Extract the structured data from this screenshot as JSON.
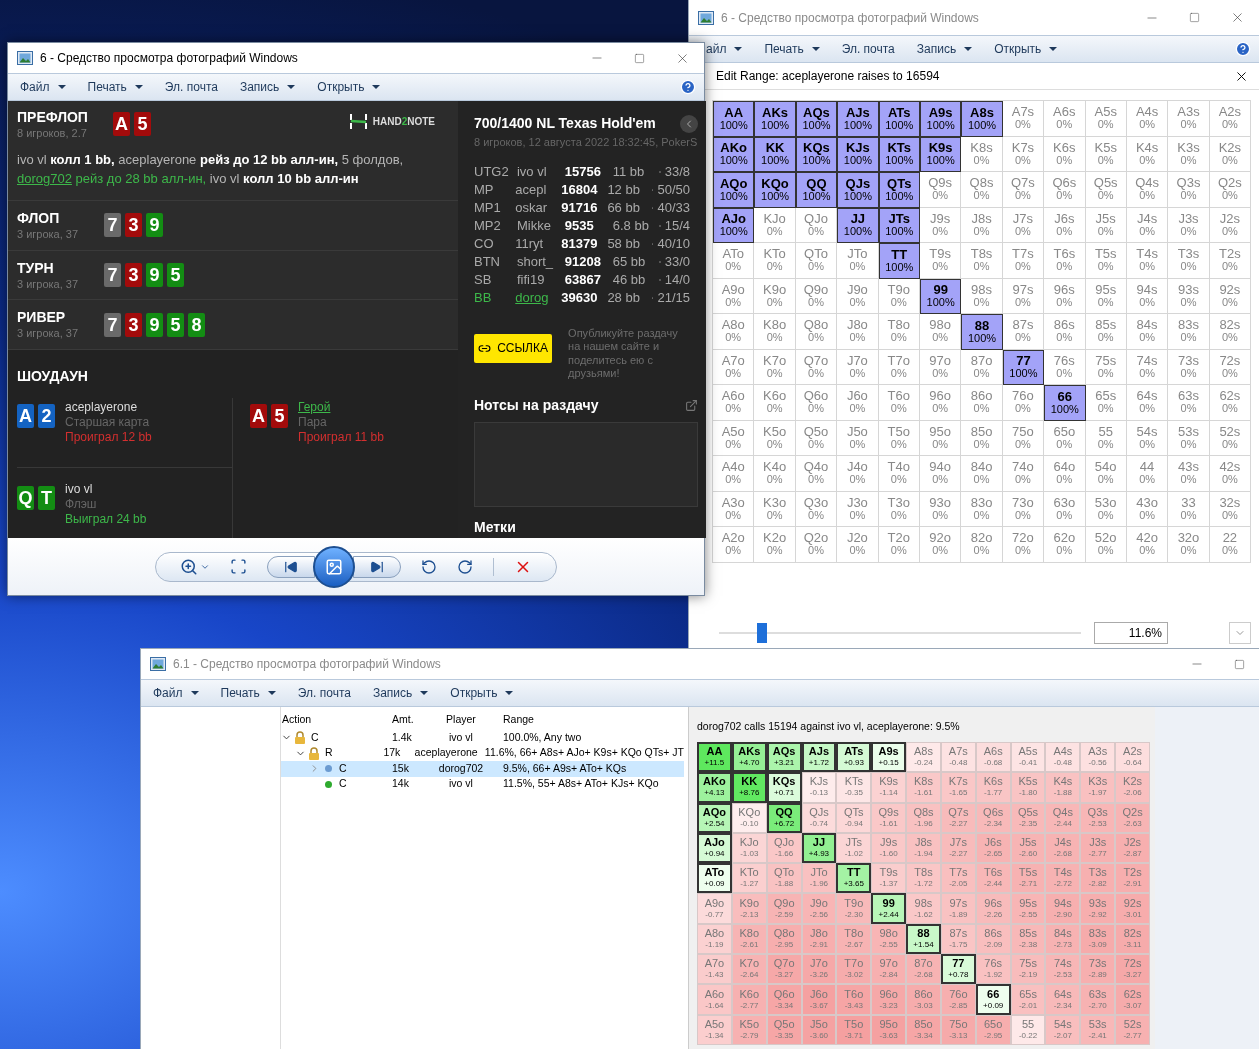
{
  "range_window": {
    "title": "6 - Средство просмотра фотографий Windows",
    "active": false,
    "menu": [
      {
        "label": "айл",
        "dropdown": true
      },
      {
        "label": "Печать",
        "dropdown": true
      },
      {
        "label": "Эл. почта",
        "dropdown": false
      },
      {
        "label": "Запись",
        "dropdown": true
      },
      {
        "label": "Открыть",
        "dropdown": true
      }
    ],
    "dialog_title": "Edit Range: aceplayerone raises to 16594",
    "grid": [
      [
        {
          "hand": "AA",
          "value": "100%",
          "selected": true
        },
        {
          "hand": "AKs",
          "value": "100%",
          "selected": true
        },
        {
          "hand": "AQs",
          "value": "100%",
          "selected": true
        },
        {
          "hand": "AJs",
          "value": "100%",
          "selected": true
        },
        {
          "hand": "ATs",
          "value": "100%",
          "selected": true
        },
        {
          "hand": "A9s",
          "value": "100%",
          "selected": true
        },
        {
          "hand": "A8s",
          "value": "100%",
          "selected": true
        },
        {
          "hand": "A7s",
          "value": "0%",
          "selected": false
        },
        {
          "hand": "A6s",
          "value": "0%",
          "selected": false
        },
        {
          "hand": "A5s",
          "value": "0%",
          "selected": false
        },
        {
          "hand": "A4s",
          "value": "0%",
          "selected": false
        },
        {
          "hand": "A3s",
          "value": "0%",
          "selected": false
        },
        {
          "hand": "A2s",
          "value": "0%",
          "selected": false
        }
      ],
      [
        {
          "hand": "AKo",
          "value": "100%",
          "selected": true
        },
        {
          "hand": "KK",
          "value": "100%",
          "selected": true
        },
        {
          "hand": "KQs",
          "value": "100%",
          "selected": true
        },
        {
          "hand": "KJs",
          "value": "100%",
          "selected": true
        },
        {
          "hand": "KTs",
          "value": "100%",
          "selected": true
        },
        {
          "hand": "K9s",
          "value": "100%",
          "selected": true
        },
        {
          "hand": "K8s",
          "value": "0%",
          "selected": false
        },
        {
          "hand": "K7s",
          "value": "0%",
          "selected": false
        },
        {
          "hand": "K6s",
          "value": "0%",
          "selected": false
        },
        {
          "hand": "K5s",
          "value": "0%",
          "selected": false
        },
        {
          "hand": "K4s",
          "value": "0%",
          "selected": false
        },
        {
          "hand": "K3s",
          "value": "0%",
          "selected": false
        },
        {
          "hand": "K2s",
          "value": "0%",
          "selected": false
        }
      ],
      [
        {
          "hand": "AQo",
          "value": "100%",
          "selected": true
        },
        {
          "hand": "KQo",
          "value": "100%",
          "selected": true
        },
        {
          "hand": "QQ",
          "value": "100%",
          "selected": true
        },
        {
          "hand": "QJs",
          "value": "100%",
          "selected": true
        },
        {
          "hand": "QTs",
          "value": "100%",
          "selected": true
        },
        {
          "hand": "Q9s",
          "value": "0%",
          "selected": false
        },
        {
          "hand": "Q8s",
          "value": "0%",
          "selected": false
        },
        {
          "hand": "Q7s",
          "value": "0%",
          "selected": false
        },
        {
          "hand": "Q6s",
          "value": "0%",
          "selected": false
        },
        {
          "hand": "Q5s",
          "value": "0%",
          "selected": false
        },
        {
          "hand": "Q4s",
          "value": "0%",
          "selected": false
        },
        {
          "hand": "Q3s",
          "value": "0%",
          "selected": false
        },
        {
          "hand": "Q2s",
          "value": "0%",
          "selected": false
        }
      ],
      [
        {
          "hand": "AJo",
          "value": "100%",
          "selected": true
        },
        {
          "hand": "KJo",
          "value": "0%",
          "selected": false
        },
        {
          "hand": "QJo",
          "value": "0%",
          "selected": false
        },
        {
          "hand": "JJ",
          "value": "100%",
          "selected": true
        },
        {
          "hand": "JTs",
          "value": "100%",
          "selected": true
        },
        {
          "hand": "J9s",
          "value": "0%",
          "selected": false
        },
        {
          "hand": "J8s",
          "value": "0%",
          "selected": false
        },
        {
          "hand": "J7s",
          "value": "0%",
          "selected": false
        },
        {
          "hand": "J6s",
          "value": "0%",
          "selected": false
        },
        {
          "hand": "J5s",
          "value": "0%",
          "selected": false
        },
        {
          "hand": "J4s",
          "value": "0%",
          "selected": false
        },
        {
          "hand": "J3s",
          "value": "0%",
          "selected": false
        },
        {
          "hand": "J2s",
          "value": "0%",
          "selected": false
        }
      ],
      [
        {
          "hand": "ATo",
          "value": "0%",
          "selected": false
        },
        {
          "hand": "KTo",
          "value": "0%",
          "selected": false
        },
        {
          "hand": "QTo",
          "value": "0%",
          "selected": false
        },
        {
          "hand": "JTo",
          "value": "0%",
          "selected": false
        },
        {
          "hand": "TT",
          "value": "100%",
          "selected": true
        },
        {
          "hand": "T9s",
          "value": "0%",
          "selected": false
        },
        {
          "hand": "T8s",
          "value": "0%",
          "selected": false
        },
        {
          "hand": "T7s",
          "value": "0%",
          "selected": false
        },
        {
          "hand": "T6s",
          "value": "0%",
          "selected": false
        },
        {
          "hand": "T5s",
          "value": "0%",
          "selected": false
        },
        {
          "hand": "T4s",
          "value": "0%",
          "selected": false
        },
        {
          "hand": "T3s",
          "value": "0%",
          "selected": false
        },
        {
          "hand": "T2s",
          "value": "0%",
          "selected": false
        }
      ],
      [
        {
          "hand": "A9o",
          "value": "0%",
          "selected": false
        },
        {
          "hand": "K9o",
          "value": "0%",
          "selected": false
        },
        {
          "hand": "Q9o",
          "value": "0%",
          "selected": false
        },
        {
          "hand": "J9o",
          "value": "0%",
          "selected": false
        },
        {
          "hand": "T9o",
          "value": "0%",
          "selected": false
        },
        {
          "hand": "99",
          "value": "100%",
          "selected": true
        },
        {
          "hand": "98s",
          "value": "0%",
          "selected": false
        },
        {
          "hand": "97s",
          "value": "0%",
          "selected": false
        },
        {
          "hand": "96s",
          "value": "0%",
          "selected": false
        },
        {
          "hand": "95s",
          "value": "0%",
          "selected": false
        },
        {
          "hand": "94s",
          "value": "0%",
          "selected": false
        },
        {
          "hand": "93s",
          "value": "0%",
          "selected": false
        },
        {
          "hand": "92s",
          "value": "0%",
          "selected": false
        }
      ],
      [
        {
          "hand": "A8o",
          "value": "0%",
          "selected": false
        },
        {
          "hand": "K8o",
          "value": "0%",
          "selected": false
        },
        {
          "hand": "Q8o",
          "value": "0%",
          "selected": false
        },
        {
          "hand": "J8o",
          "value": "0%",
          "selected": false
        },
        {
          "hand": "T8o",
          "value": "0%",
          "selected": false
        },
        {
          "hand": "98o",
          "value": "0%",
          "selected": false
        },
        {
          "hand": "88",
          "value": "100%",
          "selected": true
        },
        {
          "hand": "87s",
          "value": "0%",
          "selected": false
        },
        {
          "hand": "86s",
          "value": "0%",
          "selected": false
        },
        {
          "hand": "85s",
          "value": "0%",
          "selected": false
        },
        {
          "hand": "84s",
          "value": "0%",
          "selected": false
        },
        {
          "hand": "83s",
          "value": "0%",
          "selected": false
        },
        {
          "hand": "82s",
          "value": "0%",
          "selected": false
        }
      ],
      [
        {
          "hand": "A7o",
          "value": "0%",
          "selected": false
        },
        {
          "hand": "K7o",
          "value": "0%",
          "selected": false
        },
        {
          "hand": "Q7o",
          "value": "0%",
          "selected": false
        },
        {
          "hand": "J7o",
          "value": "0%",
          "selected": false
        },
        {
          "hand": "T7o",
          "value": "0%",
          "selected": false
        },
        {
          "hand": "97o",
          "value": "0%",
          "selected": false
        },
        {
          "hand": "87o",
          "value": "0%",
          "selected": false
        },
        {
          "hand": "77",
          "value": "100%",
          "selected": true
        },
        {
          "hand": "76s",
          "value": "0%",
          "selected": false
        },
        {
          "hand": "75s",
          "value": "0%",
          "selected": false
        },
        {
          "hand": "74s",
          "value": "0%",
          "selected": false
        },
        {
          "hand": "73s",
          "value": "0%",
          "selected": false
        },
        {
          "hand": "72s",
          "value": "0%",
          "selected": false
        }
      ],
      [
        {
          "hand": "A6o",
          "value": "0%",
          "selected": false
        },
        {
          "hand": "K6o",
          "value": "0%",
          "selected": false
        },
        {
          "hand": "Q6o",
          "value": "0%",
          "selected": false
        },
        {
          "hand": "J6o",
          "value": "0%",
          "selected": false
        },
        {
          "hand": "T6o",
          "value": "0%",
          "selected": false
        },
        {
          "hand": "96o",
          "value": "0%",
          "selected": false
        },
        {
          "hand": "86o",
          "value": "0%",
          "selected": false
        },
        {
          "hand": "76o",
          "value": "0%",
          "selected": false
        },
        {
          "hand": "66",
          "value": "100%",
          "selected": true
        },
        {
          "hand": "65s",
          "value": "0%",
          "selected": false
        },
        {
          "hand": "64s",
          "value": "0%",
          "selected": false
        },
        {
          "hand": "63s",
          "value": "0%",
          "selected": false
        },
        {
          "hand": "62s",
          "value": "0%",
          "selected": false
        }
      ],
      [
        {
          "hand": "A5o",
          "value": "0%",
          "selected": false
        },
        {
          "hand": "K5o",
          "value": "0%",
          "selected": false
        },
        {
          "hand": "Q5o",
          "value": "0%",
          "selected": false
        },
        {
          "hand": "J5o",
          "value": "0%",
          "selected": false
        },
        {
          "hand": "T5o",
          "value": "0%",
          "selected": false
        },
        {
          "hand": "95o",
          "value": "0%",
          "selected": false
        },
        {
          "hand": "85o",
          "value": "0%",
          "selected": false
        },
        {
          "hand": "75o",
          "value": "0%",
          "selected": false
        },
        {
          "hand": "65o",
          "value": "0%",
          "selected": false
        },
        {
          "hand": "55",
          "value": "0%",
          "selected": false
        },
        {
          "hand": "54s",
          "value": "0%",
          "selected": false
        },
        {
          "hand": "53s",
          "value": "0%",
          "selected": false
        },
        {
          "hand": "52s",
          "value": "0%",
          "selected": false
        }
      ],
      [
        {
          "hand": "A4o",
          "value": "0%",
          "selected": false
        },
        {
          "hand": "K4o",
          "value": "0%",
          "selected": false
        },
        {
          "hand": "Q4o",
          "value": "0%",
          "selected": false
        },
        {
          "hand": "J4o",
          "value": "0%",
          "selected": false
        },
        {
          "hand": "T4o",
          "value": "0%",
          "selected": false
        },
        {
          "hand": "94o",
          "value": "0%",
          "selected": false
        },
        {
          "hand": "84o",
          "value": "0%",
          "selected": false
        },
        {
          "hand": "74o",
          "value": "0%",
          "selected": false
        },
        {
          "hand": "64o",
          "value": "0%",
          "selected": false
        },
        {
          "hand": "54o",
          "value": "0%",
          "selected": false
        },
        {
          "hand": "44",
          "value": "0%",
          "selected": false
        },
        {
          "hand": "43s",
          "value": "0%",
          "selected": false
        },
        {
          "hand": "42s",
          "value": "0%",
          "selected": false
        }
      ],
      [
        {
          "hand": "A3o",
          "value": "0%",
          "selected": false
        },
        {
          "hand": "K3o",
          "value": "0%",
          "selected": false
        },
        {
          "hand": "Q3o",
          "value": "0%",
          "selected": false
        },
        {
          "hand": "J3o",
          "value": "0%",
          "selected": false
        },
        {
          "hand": "T3o",
          "value": "0%",
          "selected": false
        },
        {
          "hand": "93o",
          "value": "0%",
          "selected": false
        },
        {
          "hand": "83o",
          "value": "0%",
          "selected": false
        },
        {
          "hand": "73o",
          "value": "0%",
          "selected": false
        },
        {
          "hand": "63o",
          "value": "0%",
          "selected": false
        },
        {
          "hand": "53o",
          "value": "0%",
          "selected": false
        },
        {
          "hand": "43o",
          "value": "0%",
          "selected": false
        },
        {
          "hand": "33",
          "value": "0%",
          "selected": false
        },
        {
          "hand": "32s",
          "value": "0%",
          "selected": false
        }
      ],
      [
        {
          "hand": "A2o",
          "value": "0%",
          "selected": false
        },
        {
          "hand": "K2o",
          "value": "0%",
          "selected": false
        },
        {
          "hand": "Q2o",
          "value": "0%",
          "selected": false
        },
        {
          "hand": "J2o",
          "value": "0%",
          "selected": false
        },
        {
          "hand": "T2o",
          "value": "0%",
          "selected": false
        },
        {
          "hand": "92o",
          "value": "0%",
          "selected": false
        },
        {
          "hand": "82o",
          "value": "0%",
          "selected": false
        },
        {
          "hand": "72o",
          "value": "0%",
          "selected": false
        },
        {
          "hand": "62o",
          "value": "0%",
          "selected": false
        },
        {
          "hand": "52o",
          "value": "0%",
          "selected": false
        },
        {
          "hand": "42o",
          "value": "0%",
          "selected": false
        },
        {
          "hand": "32o",
          "value": "0%",
          "selected": false
        },
        {
          "hand": "22",
          "value": "0%",
          "selected": false
        }
      ]
    ],
    "slider": {
      "level": 0.12
    },
    "percent": "11.6%"
  },
  "hand_window": {
    "title": "6 - Средство просмотра фотографий Windows",
    "active": true,
    "menu": [
      {
        "label": "Файл",
        "dropdown": true
      },
      {
        "label": "Печать",
        "dropdown": true
      },
      {
        "label": "Эл. почта",
        "dropdown": false
      },
      {
        "label": "Запись",
        "dropdown": true
      },
      {
        "label": "Открыть",
        "dropdown": true
      }
    ],
    "preflop": {
      "title": "ПРЕФЛОП",
      "subtitle": "8 игроков, 2.7",
      "cards": [
        {
          "rank": "A",
          "color": "#a30b0b"
        },
        {
          "rank": "5",
          "color": "#a30b0b"
        }
      ],
      "logo": {
        "prefix": "HAND",
        "mark": "2",
        "suffix": "NOTE"
      },
      "actions": [
        {
          "text": "ivo vl",
          "kind": "player"
        },
        {
          "text": "колл 1 bb,",
          "kind": "action"
        },
        {
          "text": "aceplayerone",
          "kind": "player"
        },
        {
          "text": "рейз до 12 bb алл-ин,",
          "kind": "action"
        },
        {
          "text": "5 фолдов,",
          "kind": "player"
        },
        {
          "text": "dorog702",
          "kind": "hero"
        },
        {
          "text": "рейз до 28 bb алл-ин,",
          "kind": "hero_action"
        },
        {
          "text": "ivo vl",
          "kind": "player"
        },
        {
          "text": "колл 10 bb алл-ин",
          "kind": "action"
        }
      ]
    },
    "streets": [
      {
        "title": "ФЛОП",
        "subtitle": "3 игрока, 37",
        "cards": [
          {
            "rank": "7",
            "color": "#6a6a6a"
          },
          {
            "rank": "3",
            "color": "#a30b0b"
          },
          {
            "rank": "9",
            "color": "#138d13"
          }
        ]
      },
      {
        "title": "ТУРН",
        "subtitle": "3 игрока, 37",
        "cards": [
          {
            "rank": "7",
            "color": "#6a6a6a"
          },
          {
            "rank": "3",
            "color": "#a30b0b"
          },
          {
            "rank": "9",
            "color": "#138d13"
          },
          {
            "rank": "5",
            "color": "#138d13"
          }
        ]
      },
      {
        "title": "РИВЕР",
        "subtitle": "3 игрока, 37",
        "cards": [
          {
            "rank": "7",
            "color": "#6a6a6a"
          },
          {
            "rank": "3",
            "color": "#a30b0b"
          },
          {
            "rank": "9",
            "color": "#138d13"
          },
          {
            "rank": "5",
            "color": "#138d13"
          },
          {
            "rank": "8",
            "color": "#138d13"
          }
        ]
      }
    ],
    "showdown": {
      "title": "ШОУДАУН",
      "players": [
        {
          "cards": [
            {
              "rank": "A",
              "color": "#1463c2"
            },
            {
              "rank": "2",
              "color": "#1463c2"
            }
          ],
          "name": "aceplayerone",
          "hand": "Старшая карта",
          "result": "Проиграл 12 bb",
          "won": false,
          "hero": false
        },
        {
          "cards": [
            {
              "rank": "A",
              "color": "#a30b0b"
            },
            {
              "rank": "5",
              "color": "#a30b0b"
            }
          ],
          "name": "Герой",
          "hand": "Пара",
          "result": "Проиграл 11 bb",
          "won": false,
          "hero": true
        },
        {
          "cards": [
            {
              "rank": "Q",
              "color": "#138d13"
            },
            {
              "rank": "T",
              "color": "#138d13"
            }
          ],
          "name": "ivo vl",
          "hand": "Флэш",
          "result": "Выиграл 24 bb",
          "won": true,
          "hero": false
        }
      ]
    },
    "info": {
      "title": "700/1400 NL Texas Hold'em",
      "subtitle": "8 игроков, 12 августа 2022 18:32:45, PokerS",
      "seats": [
        {
          "position": "UTG2",
          "player": "ivo vl",
          "stack": "15756",
          "bb": "11 bb",
          "stats": "33/8",
          "hero": false
        },
        {
          "position": "MP",
          "player": "acepl",
          "stack": "16804",
          "bb": "12 bb",
          "stats": "50/50",
          "hero": false
        },
        {
          "position": "MP1",
          "player": "oskar",
          "stack": "91716",
          "bb": "66 bb",
          "stats": "40/33",
          "hero": false
        },
        {
          "position": "MP2",
          "player": "Mikke",
          "stack": "9535",
          "bb": "6.8 bb",
          "stats": "15/4",
          "hero": false
        },
        {
          "position": "CO",
          "player": "11ryt",
          "stack": "81379",
          "bb": "58 bb",
          "stats": "40/10",
          "hero": false
        },
        {
          "position": "BTN",
          "player": "short_",
          "stack": "91208",
          "bb": "65 bb",
          "stats": "33/0",
          "hero": false
        },
        {
          "position": "SB",
          "player": "fifi19",
          "stack": "63867",
          "bb": "46 bb",
          "stats": "14/0",
          "hero": false
        },
        {
          "position": "BB",
          "player": "dorog",
          "stack": "39630",
          "bb": "28 bb",
          "stats": "21/15",
          "hero": true
        }
      ],
      "link_button": "ССЫЛКА",
      "share_text": "Опубликуйте раздачу на нашем сайте и поделитесь ею с друзьями!",
      "notes_title": "Нотсы на раздачу",
      "tags_title": "Метки"
    }
  },
  "equity_window": {
    "title": "6.1 - Средство просмотра фотографий Windows",
    "active": false,
    "menu": [
      {
        "label": "Файл",
        "dropdown": true
      },
      {
        "label": "Печать",
        "dropdown": true
      },
      {
        "label": "Эл. почта",
        "dropdown": false
      },
      {
        "label": "Запись",
        "dropdown": true
      },
      {
        "label": "Открыть",
        "dropdown": true
      }
    ],
    "columns": [
      "Action",
      "Amt.",
      "Player",
      "Range"
    ],
    "tree": [
      {
        "action": "C",
        "amount": "1.4k",
        "player": "ivo vl",
        "range": "100.0%, Any two",
        "kind": "lock",
        "expanded": true,
        "selected": false,
        "children": [
          {
            "action": "R",
            "amount": "17k",
            "player": "aceplayerone",
            "range": "11.6%, 66+ A8s+ AJo+ K9s+ KQo QTs+ JT",
            "kind": "lock",
            "expanded": true,
            "selected": false,
            "children": [
              {
                "action": "C",
                "amount": "15k",
                "player": "dorog702",
                "range": "9.5%, 66+ A9s+ ATo+ KQs",
                "kind": "dot",
                "color": "#6b9bd1",
                "expanded": false,
                "selected": true
              },
              {
                "action": "C",
                "amount": "14k",
                "player": "ivo vl",
                "range": "11.5%, 55+ A8s+ ATo+ KJs+ KQo",
                "kind": "dot",
                "color": "#2eaa2e",
                "selected": false
              }
            ]
          }
        ]
      }
    ],
    "summary": "dorog702 calls 15194 against ivo vl, aceplayerone: 9.5%",
    "grid": [
      [
        {
          "hand": "AA",
          "ev": "+11.5",
          "selected": true
        },
        {
          "hand": "AKs",
          "ev": "+4.70",
          "selected": true
        },
        {
          "hand": "AQs",
          "ev": "+3.21",
          "selected": true
        },
        {
          "hand": "AJs",
          "ev": "+1.72",
          "selected": true
        },
        {
          "hand": "ATs",
          "ev": "+0.93",
          "selected": true
        },
        {
          "hand": "A9s",
          "ev": "+0.15",
          "selected": true
        },
        {
          "hand": "A8s",
          "ev": "-0.24",
          "selected": false
        },
        {
          "hand": "A7s",
          "ev": "-0.48",
          "selected": false
        },
        {
          "hand": "A6s",
          "ev": "-0.68",
          "selected": false
        },
        {
          "hand": "A5s",
          "ev": "-0.41",
          "selected": false
        },
        {
          "hand": "A4s",
          "ev": "-0.48",
          "selected": false
        },
        {
          "hand": "A3s",
          "ev": "-0.56",
          "selected": false
        },
        {
          "hand": "A2s",
          "ev": "-0.64",
          "selected": false
        }
      ],
      [
        {
          "hand": "AKo",
          "ev": "+4.13",
          "selected": true
        },
        {
          "hand": "KK",
          "ev": "+8.76",
          "selected": true
        },
        {
          "hand": "KQs",
          "ev": "+0.71",
          "selected": true
        },
        {
          "hand": "KJs",
          "ev": "-0.13",
          "selected": false
        },
        {
          "hand": "KTs",
          "ev": "-0.35",
          "selected": false
        },
        {
          "hand": "K9s",
          "ev": "-1.14",
          "selected": false
        },
        {
          "hand": "K8s",
          "ev": "-1.61",
          "selected": false
        },
        {
          "hand": "K7s",
          "ev": "-1.65",
          "selected": false
        },
        {
          "hand": "K6s",
          "ev": "-1.77",
          "selected": false
        },
        {
          "hand": "K5s",
          "ev": "-1.80",
          "selected": false
        },
        {
          "hand": "K4s",
          "ev": "-1.88",
          "selected": false
        },
        {
          "hand": "K3s",
          "ev": "-1.97",
          "selected": false
        },
        {
          "hand": "K2s",
          "ev": "-2.06",
          "selected": false
        }
      ],
      [
        {
          "hand": "AQo",
          "ev": "+2.54",
          "selected": true
        },
        {
          "hand": "KQo",
          "ev": "-0.10",
          "selected": false
        },
        {
          "hand": "QQ",
          "ev": "+6.72",
          "selected": true
        },
        {
          "hand": "QJs",
          "ev": "-0.74",
          "selected": false
        },
        {
          "hand": "QTs",
          "ev": "-0.94",
          "selected": false
        },
        {
          "hand": "Q9s",
          "ev": "-1.61",
          "selected": false
        },
        {
          "hand": "Q8s",
          "ev": "-1.96",
          "selected": false
        },
        {
          "hand": "Q7s",
          "ev": "-2.27",
          "selected": false
        },
        {
          "hand": "Q6s",
          "ev": "-2.34",
          "selected": false
        },
        {
          "hand": "Q5s",
          "ev": "-2.35",
          "selected": false
        },
        {
          "hand": "Q4s",
          "ev": "-2.44",
          "selected": false
        },
        {
          "hand": "Q3s",
          "ev": "-2.53",
          "selected": false
        },
        {
          "hand": "Q2s",
          "ev": "-2.63",
          "selected": false
        }
      ],
      [
        {
          "hand": "AJo",
          "ev": "+0.94",
          "selected": true
        },
        {
          "hand": "KJo",
          "ev": "-1.03",
          "selected": false
        },
        {
          "hand": "QJo",
          "ev": "-1.66",
          "selected": false
        },
        {
          "hand": "JJ",
          "ev": "+4.93",
          "selected": true
        },
        {
          "hand": "JTs",
          "ev": "-1.02",
          "selected": false
        },
        {
          "hand": "J9s",
          "ev": "-1.60",
          "selected": false
        },
        {
          "hand": "J8s",
          "ev": "-1.94",
          "selected": false
        },
        {
          "hand": "J7s",
          "ev": "-2.27",
          "selected": false
        },
        {
          "hand": "J6s",
          "ev": "-2.65",
          "selected": false
        },
        {
          "hand": "J5s",
          "ev": "-2.60",
          "selected": false
        },
        {
          "hand": "J4s",
          "ev": "-2.68",
          "selected": false
        },
        {
          "hand": "J3s",
          "ev": "-2.77",
          "selected": false
        },
        {
          "hand": "J2s",
          "ev": "-2.87",
          "selected": false
        }
      ],
      [
        {
          "hand": "ATo",
          "ev": "+0.09",
          "selected": true
        },
        {
          "hand": "KTo",
          "ev": "-1.27",
          "selected": false
        },
        {
          "hand": "QTo",
          "ev": "-1.88",
          "selected": false
        },
        {
          "hand": "JTo",
          "ev": "-1.96",
          "selected": false
        },
        {
          "hand": "TT",
          "ev": "+3.65",
          "selected": true
        },
        {
          "hand": "T9s",
          "ev": "-1.37",
          "selected": false
        },
        {
          "hand": "T8s",
          "ev": "-1.72",
          "selected": false
        },
        {
          "hand": "T7s",
          "ev": "-2.05",
          "selected": false
        },
        {
          "hand": "T6s",
          "ev": "-2.44",
          "selected": false
        },
        {
          "hand": "T5s",
          "ev": "-2.71",
          "selected": false
        },
        {
          "hand": "T4s",
          "ev": "-2.72",
          "selected": false
        },
        {
          "hand": "T3s",
          "ev": "-2.82",
          "selected": false
        },
        {
          "hand": "T2s",
          "ev": "-2.91",
          "selected": false
        }
      ],
      [
        {
          "hand": "A9o",
          "ev": "-0.77",
          "selected": false
        },
        {
          "hand": "K9o",
          "ev": "-2.13",
          "selected": false
        },
        {
          "hand": "Q9o",
          "ev": "-2.59",
          "selected": false
        },
        {
          "hand": "J9o",
          "ev": "-2.56",
          "selected": false
        },
        {
          "hand": "T9o",
          "ev": "-2.30",
          "selected": false
        },
        {
          "hand": "99",
          "ev": "+2.44",
          "selected": true
        },
        {
          "hand": "98s",
          "ev": "-1.62",
          "selected": false
        },
        {
          "hand": "97s",
          "ev": "-1.89",
          "selected": false
        },
        {
          "hand": "96s",
          "ev": "-2.26",
          "selected": false
        },
        {
          "hand": "95s",
          "ev": "-2.55",
          "selected": false
        },
        {
          "hand": "94s",
          "ev": "-2.90",
          "selected": false
        },
        {
          "hand": "93s",
          "ev": "-2.92",
          "selected": false
        },
        {
          "hand": "92s",
          "ev": "-3.01",
          "selected": false
        }
      ],
      [
        {
          "hand": "A8o",
          "ev": "-1.19",
          "selected": false
        },
        {
          "hand": "K8o",
          "ev": "-2.61",
          "selected": false
        },
        {
          "hand": "Q8o",
          "ev": "-2.95",
          "selected": false
        },
        {
          "hand": "J8o",
          "ev": "-2.91",
          "selected": false
        },
        {
          "hand": "T8o",
          "ev": "-2.67",
          "selected": false
        },
        {
          "hand": "98o",
          "ev": "-2.55",
          "selected": false
        },
        {
          "hand": "88",
          "ev": "+1.54",
          "selected": true
        },
        {
          "hand": "87s",
          "ev": "-1.75",
          "selected": false
        },
        {
          "hand": "86s",
          "ev": "-2.09",
          "selected": false
        },
        {
          "hand": "85s",
          "ev": "-2.38",
          "selected": false
        },
        {
          "hand": "84s",
          "ev": "-2.73",
          "selected": false
        },
        {
          "hand": "83s",
          "ev": "-3.09",
          "selected": false
        },
        {
          "hand": "82s",
          "ev": "-3.11",
          "selected": false
        }
      ],
      [
        {
          "hand": "A7o",
          "ev": "-1.43",
          "selected": false
        },
        {
          "hand": "K7o",
          "ev": "-2.64",
          "selected": false
        },
        {
          "hand": "Q7o",
          "ev": "-3.27",
          "selected": false
        },
        {
          "hand": "J7o",
          "ev": "-3.26",
          "selected": false
        },
        {
          "hand": "T7o",
          "ev": "-3.02",
          "selected": false
        },
        {
          "hand": "97o",
          "ev": "-2.84",
          "selected": false
        },
        {
          "hand": "87o",
          "ev": "-2.68",
          "selected": false
        },
        {
          "hand": "77",
          "ev": "+0.78",
          "selected": true
        },
        {
          "hand": "76s",
          "ev": "-1.92",
          "selected": false
        },
        {
          "hand": "75s",
          "ev": "-2.19",
          "selected": false
        },
        {
          "hand": "74s",
          "ev": "-2.53",
          "selected": false
        },
        {
          "hand": "73s",
          "ev": "-2.89",
          "selected": false
        },
        {
          "hand": "72s",
          "ev": "-3.27",
          "selected": false
        }
      ],
      [
        {
          "hand": "A6o",
          "ev": "-1.64",
          "selected": false
        },
        {
          "hand": "K6o",
          "ev": "-2.77",
          "selected": false
        },
        {
          "hand": "Q6o",
          "ev": "-3.34",
          "selected": false
        },
        {
          "hand": "J6o",
          "ev": "-3.67",
          "selected": false
        },
        {
          "hand": "T6o",
          "ev": "-3.43",
          "selected": false
        },
        {
          "hand": "96o",
          "ev": "-3.23",
          "selected": false
        },
        {
          "hand": "86o",
          "ev": "-3.03",
          "selected": false
        },
        {
          "hand": "76o",
          "ev": "-2.85",
          "selected": false
        },
        {
          "hand": "66",
          "ev": "+0.09",
          "selected": true
        },
        {
          "hand": "65s",
          "ev": "-2.01",
          "selected": false
        },
        {
          "hand": "64s",
          "ev": "-2.34",
          "selected": false
        },
        {
          "hand": "63s",
          "ev": "-2.70",
          "selected": false
        },
        {
          "hand": "62s",
          "ev": "-3.07",
          "selected": false
        }
      ],
      [
        {
          "hand": "A5o",
          "ev": "-1.34",
          "selected": false
        },
        {
          "hand": "K5o",
          "ev": "-2.79",
          "selected": false
        },
        {
          "hand": "Q5o",
          "ev": "-3.35",
          "selected": false
        },
        {
          "hand": "J5o",
          "ev": "-3.60",
          "selected": false
        },
        {
          "hand": "T5o",
          "ev": "-3.71",
          "selected": false
        },
        {
          "hand": "95o",
          "ev": "-3.63",
          "selected": false
        },
        {
          "hand": "85o",
          "ev": "-3.34",
          "selected": false
        },
        {
          "hand": "75o",
          "ev": "-3.13",
          "selected": false
        },
        {
          "hand": "65o",
          "ev": "-2.95",
          "selected": false
        },
        {
          "hand": "55",
          "ev": "-0.22",
          "selected": false
        },
        {
          "hand": "54s",
          "ev": "-2.07",
          "selected": false
        },
        {
          "hand": "53s",
          "ev": "-2.41",
          "selected": false
        },
        {
          "hand": "52s",
          "ev": "-2.77",
          "selected": false
        }
      ]
    ]
  }
}
